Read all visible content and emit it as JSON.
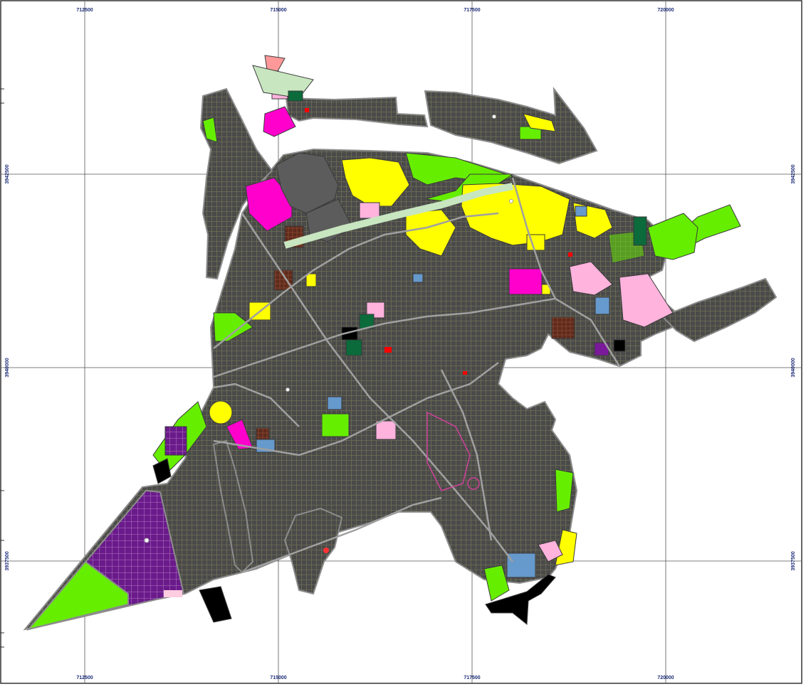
{
  "map": {
    "grid": {
      "x_labels": [
        "712500",
        "715000",
        "717500",
        "720000"
      ],
      "y_labels": [
        "3942500",
        "3940000",
        "3937500"
      ]
    },
    "colors": {
      "background": "#ffffff",
      "grid": "#555555",
      "label": "#1f2f7a",
      "urban_fabric": "#4a4a4a",
      "streets": "#8c8c8c",
      "residential": "#ffff00",
      "green_space": "#66ee00",
      "commercial": "#ff00cc",
      "public_facility": "#6699cc",
      "special_use": "#6b2a1e",
      "industrial_purple": "#7a1a9a",
      "hospital_pink": "#ffb3dd",
      "rail_corridor": "#c8e6c0",
      "dark_green": "#0b6b3a",
      "black_zone": "#000000"
    }
  }
}
